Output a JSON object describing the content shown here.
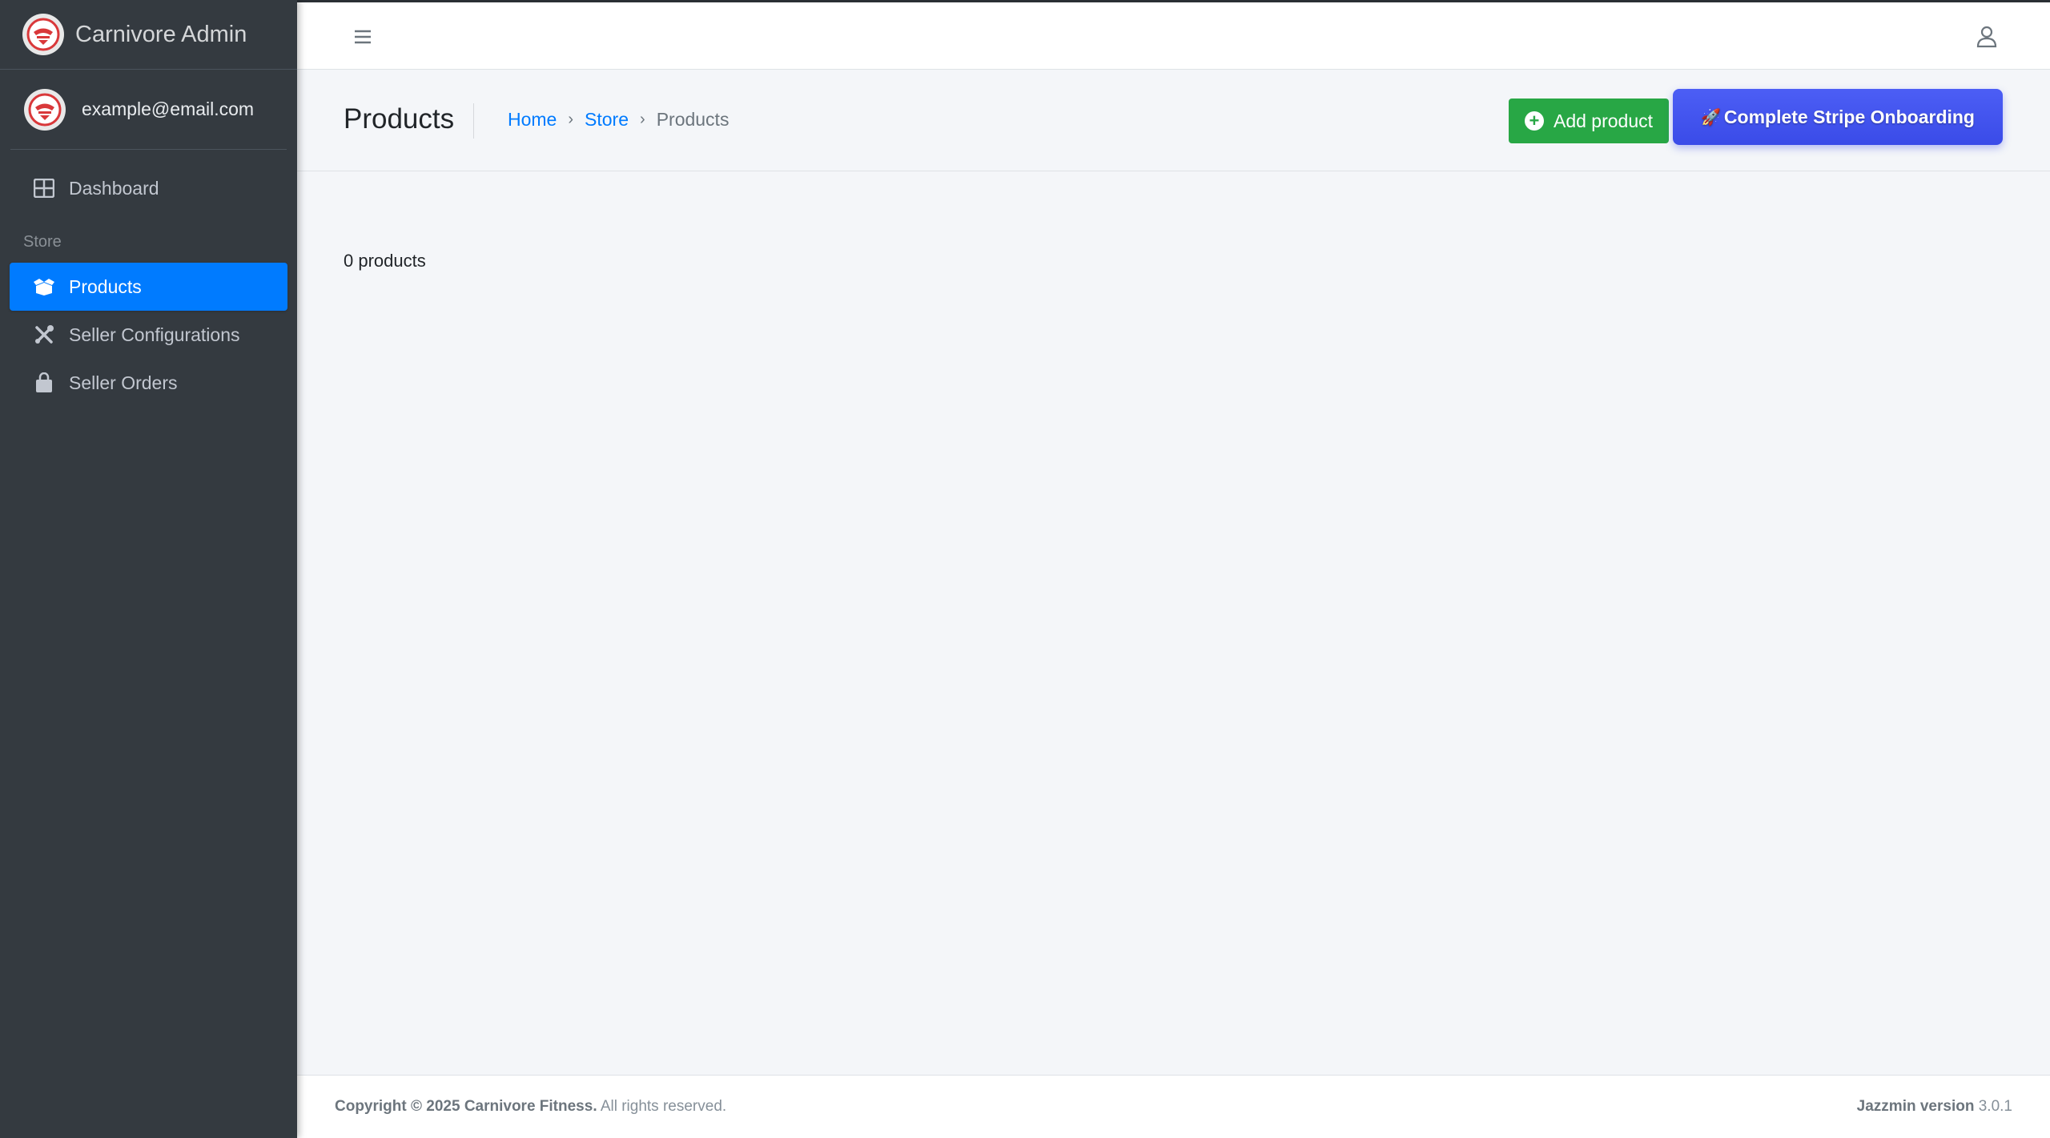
{
  "brand": {
    "title": "Carnivore Admin",
    "logo": "carnivore-logo"
  },
  "user": {
    "email": "example@email.com"
  },
  "sidebar": {
    "items": [
      {
        "label": "Dashboard",
        "icon": "dashboard-icon"
      },
      {
        "header": "Store"
      },
      {
        "label": "Products",
        "icon": "box-open-icon",
        "active": true
      },
      {
        "label": "Seller Configurations",
        "icon": "tools-icon"
      },
      {
        "label": "Seller Orders",
        "icon": "shopping-bag-icon"
      }
    ]
  },
  "topbar": {
    "menu_icon": "hamburger-icon",
    "user_icon": "user-icon"
  },
  "header": {
    "title": "Products",
    "breadcrumb": [
      "Home",
      "Store",
      "Products"
    ],
    "add_button": "Add product",
    "stripe_button": "Complete Stripe Onboarding"
  },
  "main": {
    "count_text": "0 products"
  },
  "footer": {
    "copyright_bold": "Copyright © 2025 Carnivore Fitness.",
    "copyright_rest": " All rights reserved.",
    "version_label": "Jazzmin version",
    "version_number": " 3.0.1"
  },
  "colors": {
    "sidebar_bg": "#343a40",
    "active_item": "#007bff",
    "add_button": "#28a745",
    "stripe_button": "#4c5ef5",
    "link": "#007bff"
  }
}
